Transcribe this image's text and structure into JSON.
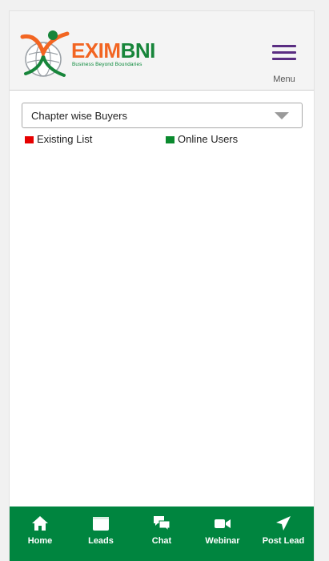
{
  "header": {
    "logo": {
      "name_part1": "EXIM",
      "name_part2": "BNI",
      "tagline": "Business Beyond Boundaries"
    },
    "menu_label": "Menu"
  },
  "filter": {
    "selected": "Chapter wise Buyers"
  },
  "legend": [
    {
      "label": "Existing List",
      "color": "#e60000"
    },
    {
      "label": "Online Users",
      "color": "#0a8a2e"
    }
  ],
  "bottom_nav": [
    {
      "label": "Home",
      "icon": "home-icon"
    },
    {
      "label": "Leads",
      "icon": "leads-icon"
    },
    {
      "label": "Chat",
      "icon": "chat-icon"
    },
    {
      "label": "Webinar",
      "icon": "video-icon"
    },
    {
      "label": "Post Lead",
      "icon": "send-icon"
    }
  ],
  "colors": {
    "nav_background": "#00853f",
    "menu_icon": "#5a2d82",
    "brand_orange": "#f26522",
    "brand_green": "#17853a"
  }
}
